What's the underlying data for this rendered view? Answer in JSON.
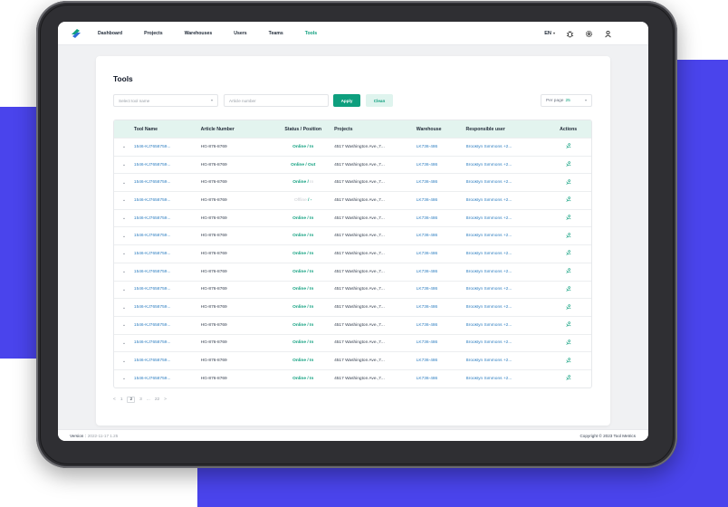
{
  "nav": {
    "items": [
      {
        "label": "Dashboard",
        "active": false
      },
      {
        "label": "Projects",
        "active": false
      },
      {
        "label": "Warehouses",
        "active": false
      },
      {
        "label": "Users",
        "active": false
      },
      {
        "label": "Teams",
        "active": false
      },
      {
        "label": "Tools",
        "active": true
      }
    ],
    "language": "EN",
    "icons": [
      "bug-icon",
      "gear-icon",
      "user-icon"
    ]
  },
  "page": {
    "title": "Tools"
  },
  "filters": {
    "tool_name_placeholder": "Select tool name",
    "article_number_placeholder": "Article number",
    "apply_label": "Apply",
    "clean_label": "Clean",
    "per_page_label": "Per page",
    "per_page_value": "25"
  },
  "table": {
    "headers": [
      "Tool Name",
      "Article Number",
      "Status / Position",
      "Projects",
      "Warehouse",
      "Responsible user",
      "Actions"
    ],
    "rows": [
      {
        "tool": "1546-KJ7658759...",
        "article": "HG-876-8769",
        "status": "Online",
        "position": "In",
        "project": "4517 Washington Ave.,7...",
        "warehouse": "LK736-486",
        "user": "Brooklyn Simmons +2...",
        "faded": false
      },
      {
        "tool": "1546-KJ7658759...",
        "article": "HG-876-8769",
        "status": "Online",
        "position": "Out",
        "project": "4517 Washington Ave.,7...",
        "warehouse": "LK736-486",
        "user": "Brooklyn Simmons +2...",
        "faded": false
      },
      {
        "tool": "1546-KJ7658759...",
        "article": "HG-876-8769",
        "status": "Online",
        "position": "In",
        "project": "4517 Washington Ave.,7...",
        "warehouse": "LK736-486",
        "user": "Brooklyn Simmons +2...",
        "faded": "position"
      },
      {
        "tool": "1546-KJ7658759...",
        "article": "HG-876-8769",
        "status": "Offline",
        "position": "-",
        "project": "4517 Washington Ave.,7...",
        "warehouse": "LK736-486",
        "user": "Brooklyn Simmons +2...",
        "faded": "status"
      },
      {
        "tool": "1546-KJ7658759...",
        "article": "HG-876-8769",
        "status": "Online",
        "position": "In",
        "project": "4517 Washington Ave.,7...",
        "warehouse": "LK736-486",
        "user": "Brooklyn Simmons +2...",
        "faded": false
      },
      {
        "tool": "1546-KJ7658759...",
        "article": "HG-876-8769",
        "status": "Online",
        "position": "In",
        "project": "4517 Washington Ave.,7...",
        "warehouse": "LK736-486",
        "user": "Brooklyn Simmons +2...",
        "faded": false
      },
      {
        "tool": "1546-KJ7658759...",
        "article": "HG-876-8769",
        "status": "Online",
        "position": "In",
        "project": "4517 Washington Ave.,7...",
        "warehouse": "LK736-486",
        "user": "Brooklyn Simmons +2...",
        "faded": false
      },
      {
        "tool": "1546-KJ7658759...",
        "article": "HG-876-8769",
        "status": "Online",
        "position": "In",
        "project": "4517 Washington Ave.,7...",
        "warehouse": "LK736-486",
        "user": "Brooklyn Simmons +2...",
        "faded": false
      },
      {
        "tool": "1546-KJ7658759...",
        "article": "HG-876-8769",
        "status": "Online",
        "position": "In",
        "project": "4517 Washington Ave.,7...",
        "warehouse": "LK736-486",
        "user": "Brooklyn Simmons +2...",
        "faded": false
      },
      {
        "tool": "1546-KJ7658759...",
        "article": "HG-876-8769",
        "status": "Online",
        "position": "In",
        "project": "4517 Washington Ave.,7...",
        "warehouse": "LK736-486",
        "user": "Brooklyn Simmons +2...",
        "faded": false
      },
      {
        "tool": "1546-KJ7658759...",
        "article": "HG-876-8769",
        "status": "Online",
        "position": "In",
        "project": "4517 Washington Ave.,7...",
        "warehouse": "LK736-486",
        "user": "Brooklyn Simmons +2...",
        "faded": false
      },
      {
        "tool": "1546-KJ7658759...",
        "article": "HG-876-8769",
        "status": "Online",
        "position": "In",
        "project": "4517 Washington Ave.,7...",
        "warehouse": "LK736-486",
        "user": "Brooklyn Simmons +2...",
        "faded": false
      },
      {
        "tool": "1546-KJ7658759...",
        "article": "HG-876-8769",
        "status": "Online",
        "position": "In",
        "project": "4517 Washington Ave.,7...",
        "warehouse": "LK736-486",
        "user": "Brooklyn Simmons +2...",
        "faded": false
      },
      {
        "tool": "1546-KJ7658759...",
        "article": "HG-876-8769",
        "status": "Online",
        "position": "In",
        "project": "4517 Washington Ave.,7...",
        "warehouse": "LK736-486",
        "user": "Brooklyn Simmons +2...",
        "faded": false
      }
    ]
  },
  "pagination": {
    "prev": "<",
    "pages": [
      "1",
      "2",
      "3"
    ],
    "current": "2",
    "ellipsis": "...",
    "last": "22",
    "next": ">"
  },
  "footer": {
    "version_label": "Version :",
    "version_value": "2022-11-17 1.25",
    "copyright": "Copyright © 2023 Tool Metrics"
  },
  "colors": {
    "accent": "#0e9f7e",
    "link": "#2f7fc1",
    "backdrop": "#4a44ec"
  }
}
